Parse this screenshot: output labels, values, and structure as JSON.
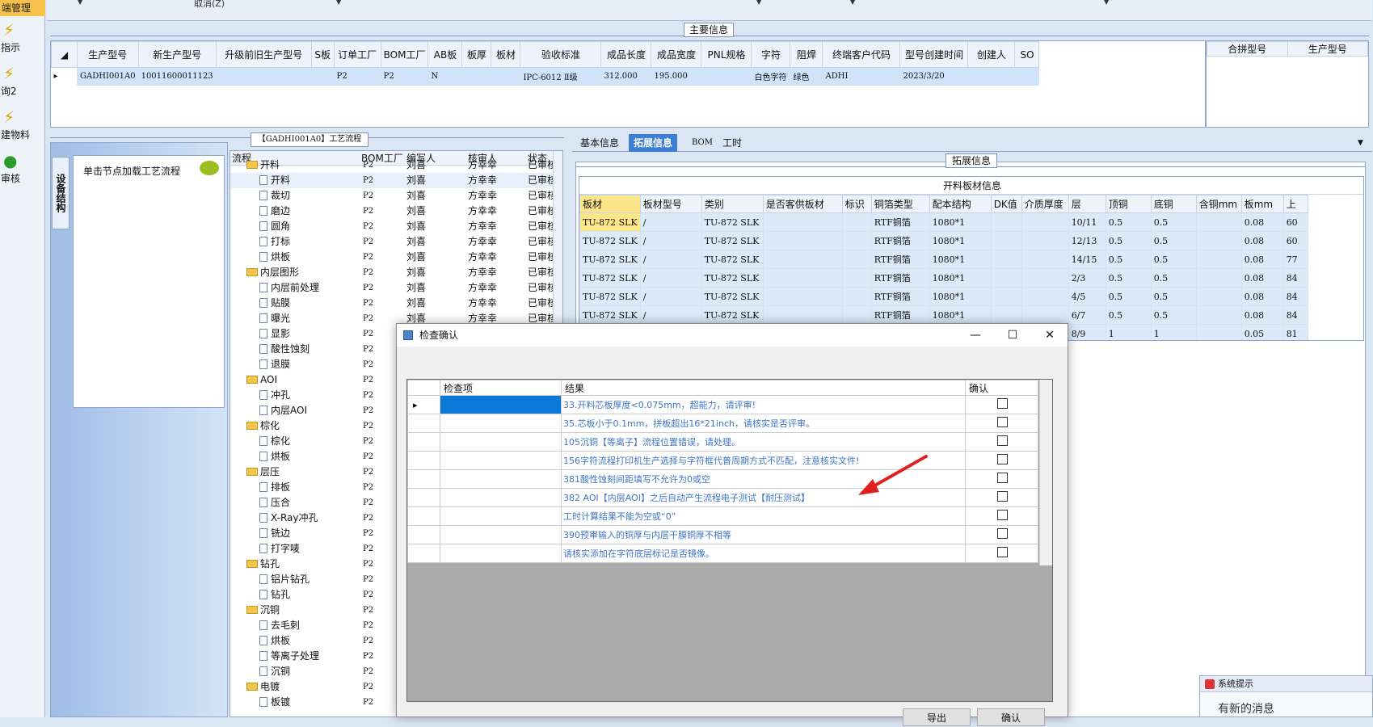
{
  "sidebar": {
    "top_label": "端管理",
    "items": [
      {
        "label": "指示"
      },
      {
        "label": "询2"
      },
      {
        "label": "建物料"
      },
      {
        "label": "审核"
      }
    ]
  },
  "topbar": {
    "cancel_label": "取消(Z)"
  },
  "main_info": {
    "caption": "主要信息",
    "columns": [
      "生产型号",
      "新生产型号",
      "升级前旧生产型号",
      "S板",
      "订单工厂",
      "BOM工厂",
      "AB板",
      "板厚",
      "板材",
      "验收标准",
      "成品长度",
      "成品宽度",
      "PNL规格",
      "字符",
      "阻焊",
      "终端客户代码",
      "型号创建时间",
      "创建人",
      "SO"
    ],
    "row": [
      "GADHI001A0",
      "10011600011123",
      "",
      "",
      "P2",
      "P2",
      "N",
      "",
      "",
      "IPC-6012 Ⅱ级",
      "312.000",
      "195.000",
      "",
      "白色字符",
      "绿色",
      "ADHI",
      "2023/3/20",
      "",
      ""
    ],
    "right_columns": [
      "合拼型号",
      "生产型号"
    ]
  },
  "process": {
    "caption": "【GADHI001A0】工艺流程",
    "vertical_tab": "设备结构",
    "node_hint": "单击节点加载工艺流程",
    "columns": [
      "流程",
      "BOM工厂",
      "编写人",
      "核审人",
      "状态"
    ],
    "rows": [
      {
        "name": "开料",
        "type": "folder",
        "factory": "P2",
        "writer": "刘喜",
        "reviewer": "方幸幸",
        "status": "已审核"
      },
      {
        "name": "开料",
        "type": "doc",
        "factory": "P2",
        "writer": "刘喜",
        "reviewer": "方幸幸",
        "status": "已审核"
      },
      {
        "name": "裁切",
        "type": "doc",
        "factory": "P2",
        "writer": "刘喜",
        "reviewer": "方幸幸",
        "status": "已审核"
      },
      {
        "name": "磨边",
        "type": "doc",
        "factory": "P2",
        "writer": "刘喜",
        "reviewer": "方幸幸",
        "status": "已审核"
      },
      {
        "name": "圆角",
        "type": "doc",
        "factory": "P2",
        "writer": "刘喜",
        "reviewer": "方幸幸",
        "status": "已审核"
      },
      {
        "name": "打标",
        "type": "doc",
        "factory": "P2",
        "writer": "刘喜",
        "reviewer": "方幸幸",
        "status": "已审核"
      },
      {
        "name": "烘板",
        "type": "doc",
        "factory": "P2",
        "writer": "刘喜",
        "reviewer": "方幸幸",
        "status": "已审核"
      },
      {
        "name": "内层图形",
        "type": "folder",
        "factory": "P2",
        "writer": "刘喜",
        "reviewer": "方幸幸",
        "status": "已审核"
      },
      {
        "name": "内层前处理",
        "type": "doc",
        "factory": "P2",
        "writer": "刘喜",
        "reviewer": "方幸幸",
        "status": "已审核"
      },
      {
        "name": "贴膜",
        "type": "doc",
        "factory": "P2",
        "writer": "刘喜",
        "reviewer": "方幸幸",
        "status": "已审核"
      },
      {
        "name": "曝光",
        "type": "doc",
        "factory": "P2",
        "writer": "刘喜",
        "reviewer": "方幸幸",
        "status": "已审核"
      },
      {
        "name": "显影",
        "type": "doc",
        "factory": "P2",
        "writer": "",
        "reviewer": "",
        "status": ""
      },
      {
        "name": "酸性蚀刻",
        "type": "doc",
        "factory": "P2",
        "writer": "",
        "reviewer": "",
        "status": ""
      },
      {
        "name": "退膜",
        "type": "doc",
        "factory": "P2",
        "writer": "",
        "reviewer": "",
        "status": ""
      },
      {
        "name": "AOI",
        "type": "folder",
        "factory": "P2",
        "writer": "",
        "reviewer": "",
        "status": ""
      },
      {
        "name": "冲孔",
        "type": "doc",
        "factory": "P2",
        "writer": "",
        "reviewer": "",
        "status": ""
      },
      {
        "name": "内层AOI",
        "type": "doc",
        "factory": "P2",
        "writer": "",
        "reviewer": "",
        "status": ""
      },
      {
        "name": "棕化",
        "type": "folder",
        "factory": "P2",
        "writer": "",
        "reviewer": "",
        "status": ""
      },
      {
        "name": "棕化",
        "type": "doc",
        "factory": "P2",
        "writer": "",
        "reviewer": "",
        "status": ""
      },
      {
        "name": "烘板",
        "type": "doc",
        "factory": "P2",
        "writer": "",
        "reviewer": "",
        "status": ""
      },
      {
        "name": "层压",
        "type": "folder",
        "factory": "P2",
        "writer": "",
        "reviewer": "",
        "status": ""
      },
      {
        "name": "排板",
        "type": "doc",
        "factory": "P2",
        "writer": "",
        "reviewer": "",
        "status": ""
      },
      {
        "name": "压合",
        "type": "doc",
        "factory": "P2",
        "writer": "",
        "reviewer": "",
        "status": ""
      },
      {
        "name": "X-Ray冲孔",
        "type": "doc",
        "factory": "P2",
        "writer": "",
        "reviewer": "",
        "status": ""
      },
      {
        "name": "铣边",
        "type": "doc",
        "factory": "P2",
        "writer": "",
        "reviewer": "",
        "status": ""
      },
      {
        "name": "打字唛",
        "type": "doc",
        "factory": "P2",
        "writer": "",
        "reviewer": "",
        "status": ""
      },
      {
        "name": "钻孔",
        "type": "folder",
        "factory": "P2",
        "writer": "",
        "reviewer": "",
        "status": ""
      },
      {
        "name": "铝片钻孔",
        "type": "doc",
        "factory": "P2",
        "writer": "",
        "reviewer": "",
        "status": ""
      },
      {
        "name": "钻孔",
        "type": "doc",
        "factory": "P2",
        "writer": "",
        "reviewer": "",
        "status": ""
      },
      {
        "name": "沉铜",
        "type": "folder",
        "factory": "P2",
        "writer": "",
        "reviewer": "",
        "status": ""
      },
      {
        "name": "去毛刺",
        "type": "doc",
        "factory": "P2",
        "writer": "",
        "reviewer": "",
        "status": ""
      },
      {
        "name": "烘板",
        "type": "doc",
        "factory": "P2",
        "writer": "",
        "reviewer": "",
        "status": ""
      },
      {
        "name": "等离子处理",
        "type": "doc",
        "factory": "P2",
        "writer": "",
        "reviewer": "",
        "status": ""
      },
      {
        "name": "沉铜",
        "type": "doc",
        "factory": "P2",
        "writer": "",
        "reviewer": "",
        "status": ""
      },
      {
        "name": "电镀",
        "type": "folder",
        "factory": "P2",
        "writer": "",
        "reviewer": "",
        "status": ""
      },
      {
        "name": "板镀",
        "type": "doc",
        "factory": "P2",
        "writer": "",
        "reviewer": "",
        "status": ""
      }
    ]
  },
  "tabs": [
    {
      "label": "基本信息"
    },
    {
      "label": "拓展信息",
      "active": true
    },
    {
      "label": "BOM"
    },
    {
      "label": "工时"
    }
  ],
  "ext": {
    "caption": "拓展信息",
    "title": "开料板材信息",
    "columns": [
      "板材",
      "板材型号",
      "类别",
      "是否客供板材",
      "标识",
      "铜箔类型",
      "配本结构",
      "DK值",
      "介质厚度",
      "层",
      "顶铜",
      "底铜",
      "含铜mm",
      "板mm",
      "上"
    ],
    "rows": [
      [
        "TU-872 SLK",
        "/",
        "TU-872 SLK",
        "",
        "",
        "RTF铜箔",
        "1080*1",
        "",
        "",
        "10/11",
        "0.5",
        "0.5",
        "",
        "0.08",
        "60"
      ],
      [
        "TU-872 SLK",
        "/",
        "TU-872 SLK",
        "",
        "",
        "RTF铜箔",
        "1080*1",
        "",
        "",
        "12/13",
        "0.5",
        "0.5",
        "",
        "0.08",
        "60"
      ],
      [
        "TU-872 SLK",
        "/",
        "TU-872 SLK",
        "",
        "",
        "RTF铜箔",
        "1080*1",
        "",
        "",
        "14/15",
        "0.5",
        "0.5",
        "",
        "0.08",
        "77"
      ],
      [
        "TU-872 SLK",
        "/",
        "TU-872 SLK",
        "",
        "",
        "RTF铜箔",
        "1080*1",
        "",
        "",
        "2/3",
        "0.5",
        "0.5",
        "",
        "0.08",
        "84"
      ],
      [
        "TU-872 SLK",
        "/",
        "TU-872 SLK",
        "",
        "",
        "RTF铜箔",
        "1080*1",
        "",
        "",
        "4/5",
        "0.5",
        "0.5",
        "",
        "0.08",
        "84"
      ],
      [
        "TU-872 SLK",
        "/",
        "TU-872 SLK",
        "",
        "",
        "RTF铜箔",
        "1080*1",
        "",
        "",
        "6/7",
        "0.5",
        "0.5",
        "",
        "0.08",
        "84"
      ],
      [
        "",
        "",
        "",
        "",
        "",
        "",
        "",
        "",
        "",
        "8/9",
        "1",
        "1",
        "",
        "0.05",
        "81"
      ]
    ]
  },
  "dialog": {
    "title": "检查确认",
    "columns": [
      "检查项",
      "结果",
      "确认"
    ],
    "rows": [
      {
        "result": "33.开料芯板厚度<0.075mm，超能力，请评审!"
      },
      {
        "result": "35.芯板小于0.1mm，拼板超出16*21inch，请核实是否评审。"
      },
      {
        "result": "105沉铜【等离子】流程位置错误，请处理。"
      },
      {
        "result": "156字符流程打印机生产选择与字符框代普周期方式不匹配，注意核实文件!"
      },
      {
        "result": "381酸性蚀刻间距填写不允许为0或空"
      },
      {
        "result": "382 AOI【内层AOI】之后自动产生流程电子测试【耐压测试】"
      },
      {
        "result": "工时计算结果不能为空或“0”"
      },
      {
        "result": "390预审输入的铜厚与内层干膜铜厚不相等"
      },
      {
        "result": "请核实添加在字符底层标记是否镜像。"
      }
    ],
    "btn_left": "导出",
    "btn_right": "确认"
  },
  "system": {
    "title": "系统提示",
    "text": "有新的消息"
  },
  "colors": {
    "accent": "#3d7fd0",
    "link": "#3f76c6",
    "arrow": "#e02020",
    "highlight": "#fde68a"
  }
}
